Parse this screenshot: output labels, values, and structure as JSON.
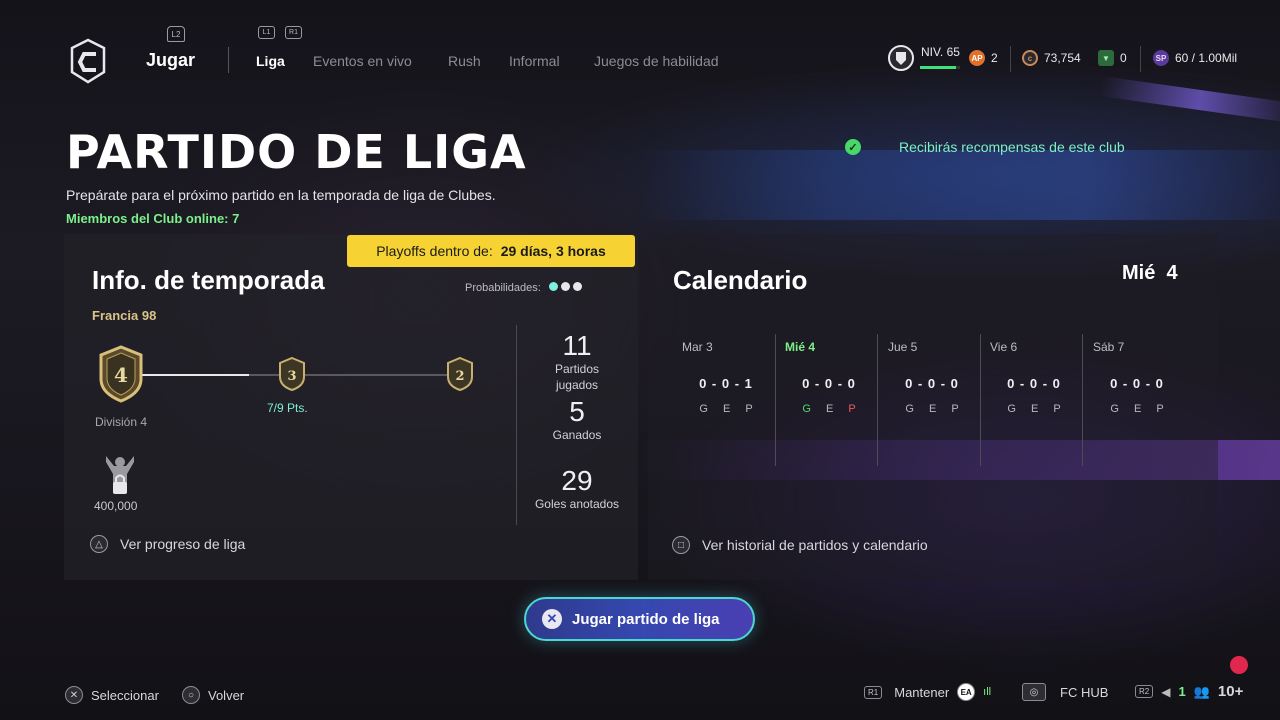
{
  "header": {
    "section": "Jugar",
    "section_trigger": "L2",
    "tab_triggers": {
      "left": "L1",
      "right": "R1"
    },
    "tabs": [
      {
        "label": "Liga",
        "active": true
      },
      {
        "label": "Eventos en vivo",
        "active": false
      },
      {
        "label": "Rush",
        "active": false
      },
      {
        "label": "Informal",
        "active": false
      },
      {
        "label": "Juegos de habilidad",
        "active": false
      }
    ],
    "level": {
      "label": "NIV. 65",
      "progress": 0.9
    },
    "ap": {
      "icon": "AP",
      "value": "2"
    },
    "coins": {
      "value": "73,754"
    },
    "tokens": {
      "value": "0"
    },
    "sp": {
      "icon": "SP",
      "value": "60 / 1.00Mil"
    }
  },
  "page": {
    "title": "PARTIDO DE LIGA",
    "subtitle": "Prepárate para el próximo partido en la temporada de liga de Clubes.",
    "online": "Miembros del Club online: 7",
    "reward_notice": "Recibirás recompensas de este club"
  },
  "season": {
    "playoffs_label": "Playoffs dentro de:",
    "playoffs_value": "29 días, 3 horas",
    "title": "Info. de temporada",
    "probabilities_label": "Probabilidades:",
    "club_name": "Francia 98",
    "division_current": "4",
    "division_next": "3",
    "division_top": "2",
    "division_label": "División 4",
    "points": "7/9 Pts.",
    "progress": 0.33,
    "reward_value": "400,000",
    "progress_link": "Ver progreso de liga",
    "stats": [
      {
        "value": "11",
        "label": "Partidos jugados"
      },
      {
        "value": "5",
        "label": "Ganados"
      },
      {
        "value": "29",
        "label": "Goles anotados"
      }
    ]
  },
  "calendar": {
    "title": "Calendario",
    "current_day": "Mié",
    "current_num": "4",
    "days": [
      {
        "name": "Mar 3",
        "score": "0 - 0 - 1",
        "gep": [
          "G",
          "E",
          "P"
        ],
        "today": false
      },
      {
        "name": "Mié 4",
        "score": "0 - 0 - 0",
        "gep": [
          "G",
          "E",
          "P"
        ],
        "today": true
      },
      {
        "name": "Jue 5",
        "score": "0 - 0 - 0",
        "gep": [
          "G",
          "E",
          "P"
        ],
        "today": false
      },
      {
        "name": "Vie 6",
        "score": "0 - 0 - 0",
        "gep": [
          "G",
          "E",
          "P"
        ],
        "today": false
      },
      {
        "name": "Sáb 7",
        "score": "0 - 0 - 0",
        "gep": [
          "G",
          "E",
          "P"
        ],
        "today": false
      }
    ],
    "history_link": "Ver historial de partidos y calendario"
  },
  "play_button": "Jugar partido de liga",
  "footer": {
    "select": "Seleccionar",
    "back": "Volver",
    "hold_trigger": "R1",
    "hold": "Mantener",
    "hold_badge": "EA",
    "hub": "FC HUB",
    "r2_trigger": "R2",
    "mic_count": "1",
    "party": "10+"
  },
  "colors": {
    "accent_green": "#7cf08a",
    "playoffs_yellow": "#f6d332",
    "teal": "#7df0d0",
    "button_border": "#4ad8d0"
  }
}
